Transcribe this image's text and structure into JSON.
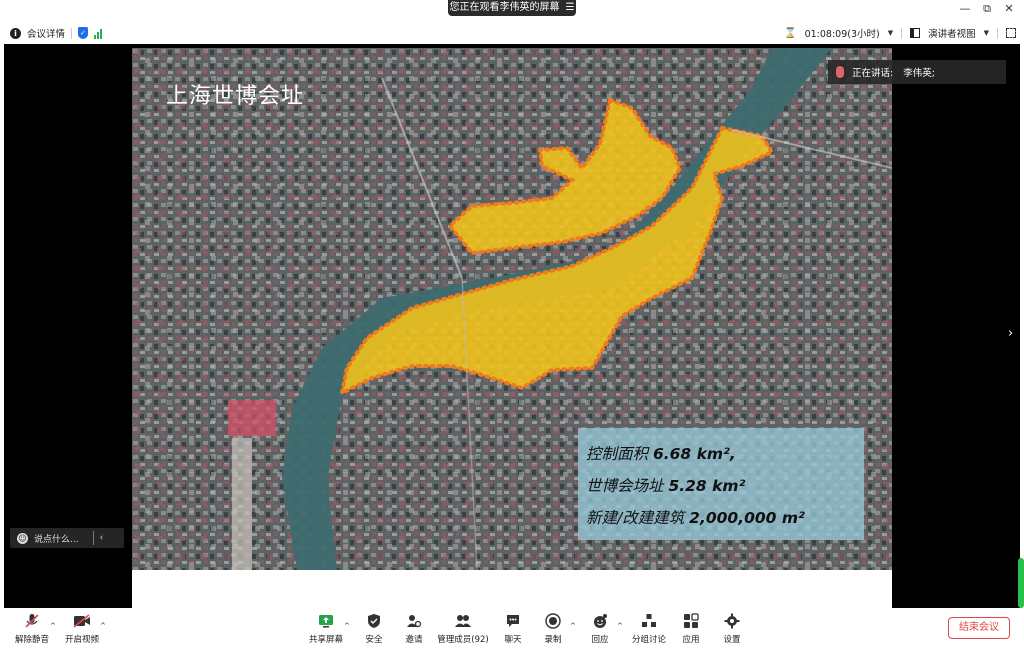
{
  "window": {
    "share_banner": "您正在观看李伟英的屏幕",
    "minimize": "—",
    "restore": "⧉",
    "close": "✕"
  },
  "infobar": {
    "meeting_details": "会议详情",
    "timer": "01:08:09(3小时)",
    "view_mode": "演讲者视图"
  },
  "speaker": {
    "label": "正在讲话:",
    "name": "李伟英;"
  },
  "chat": {
    "placeholder": "说点什么..."
  },
  "slide": {
    "title": "上海世博会址",
    "stats": [
      {
        "label": "控制面积",
        "value": "6.68 km²,"
      },
      {
        "label": "世博会场址",
        "value": "5.28 km²"
      },
      {
        "label": "新建/改建建筑",
        "value": "2,000,000 m²"
      }
    ]
  },
  "toolbar": {
    "unmute": "解除静音",
    "start_video": "开启视频",
    "share_screen": "共享屏幕",
    "security": "安全",
    "invite": "邀请",
    "manage_members": "管理成员(92)",
    "chat": "聊天",
    "record": "录制",
    "reactions": "回应",
    "breakout": "分组讨论",
    "apps": "应用",
    "settings": "设置",
    "end_meeting": "结束会议"
  },
  "colors": {
    "highlight_fill": "#f2c41a",
    "highlight_border": "#f07a1e",
    "end_button": "#e04848",
    "security_blue": "#1a6fe8",
    "signal_green": "#27b04b"
  }
}
